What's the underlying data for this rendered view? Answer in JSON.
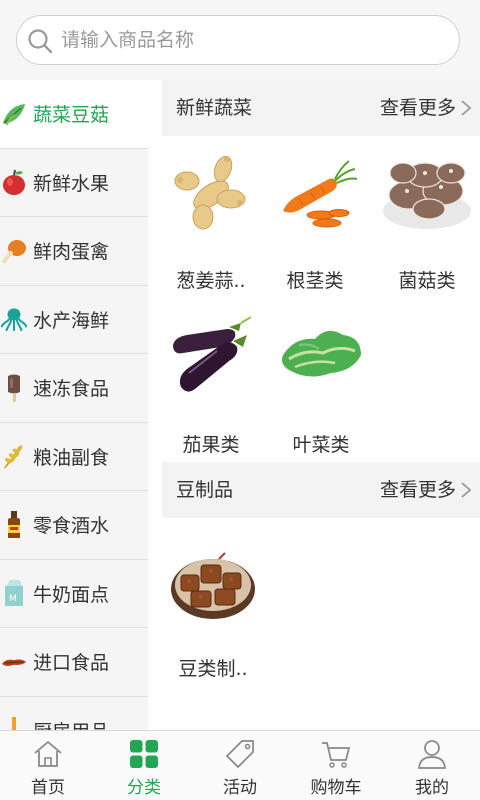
{
  "search": {
    "placeholder": "请输入商品名称",
    "icon": "search-icon"
  },
  "sidebar": {
    "accent_color": "#21a654",
    "items": [
      {
        "label": "蔬菜豆菇",
        "icon": "vegetable-icon",
        "active": true
      },
      {
        "label": "新鲜水果",
        "icon": "apple-icon"
      },
      {
        "label": "鲜肉蛋禽",
        "icon": "drumstick-icon"
      },
      {
        "label": "水产海鲜",
        "icon": "octopus-icon"
      },
      {
        "label": "速冻食品",
        "icon": "popsicle-icon"
      },
      {
        "label": "粮油副食",
        "icon": "wheat-icon"
      },
      {
        "label": "零食酒水",
        "icon": "bottle-icon"
      },
      {
        "label": "牛奶面点",
        "icon": "milk-icon"
      },
      {
        "label": "进口食品",
        "icon": "imported-food-icon"
      },
      {
        "label": "厨房用品",
        "icon": "kitchen-icon"
      }
    ]
  },
  "sections": [
    {
      "title": "新鲜蔬菜",
      "more_label": "查看更多",
      "items": [
        {
          "name": "葱姜蒜..",
          "image": "ginger-image"
        },
        {
          "name": "根茎类",
          "image": "carrot-image"
        },
        {
          "name": "菌菇类",
          "image": "mushroom-image"
        },
        {
          "name": "茄果类",
          "image": "eggplant-image"
        },
        {
          "name": "叶菜类",
          "image": "lettuce-image"
        }
      ]
    },
    {
      "title": "豆制品",
      "more_label": "查看更多",
      "items": [
        {
          "name": "豆类制..",
          "image": "tofu-image"
        }
      ]
    }
  ],
  "tabbar": {
    "items": [
      {
        "label": "首页",
        "icon": "home-icon"
      },
      {
        "label": "分类",
        "icon": "category-icon",
        "active": true
      },
      {
        "label": "活动",
        "icon": "tag-icon"
      },
      {
        "label": "购物车",
        "icon": "cart-icon"
      },
      {
        "label": "我的",
        "icon": "user-icon"
      }
    ]
  }
}
